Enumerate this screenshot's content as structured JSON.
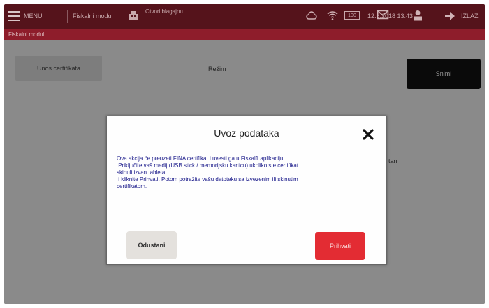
{
  "header": {
    "menu_label": "MENU",
    "module_label": "Fiskalni modul",
    "register_label": "Otvori blagajnu",
    "battery_label": "100",
    "datetime": "12.6.2018 13:43",
    "exit_label": "IZLAZ"
  },
  "breadcrumb": {
    "label": "Fiskalni modul"
  },
  "main": {
    "tab_certificate": "Unos certifikata",
    "mode_label": "Režim",
    "save_label": "Snimi",
    "partial_text": "tan"
  },
  "modal": {
    "title": "Uvoz podataka",
    "lines": [
      "Ova akcija će preuzeti FINA certifikat i uvesti ga u Fiskal1 aplikaciju.",
      " Priključite vaš medij (USB stick / memorijsku karticu) ukoliko ste certifikat",
      "skinuli izvan tableta",
      " i kliknite Prihvati. Potom potražite vašu datoteku sa izvezenim ili skinutim",
      "certifikatom."
    ],
    "cancel_label": "Odustani",
    "accept_label": "Prihvati"
  },
  "icons": {
    "menu": "hamburger-icon",
    "register": "cash-register-icon",
    "cloud": "cloud-icon",
    "wifi": "wifi-icon",
    "battery": "battery-icon",
    "mail": "mail-icon",
    "user": "user-icon",
    "exit": "exit-arrow-icon",
    "close": "close-icon"
  },
  "colors": {
    "topbar": "#55131b",
    "breadcrumb": "#8e1d2b",
    "accept": "#e32c33",
    "save": "#0a0a0a"
  }
}
